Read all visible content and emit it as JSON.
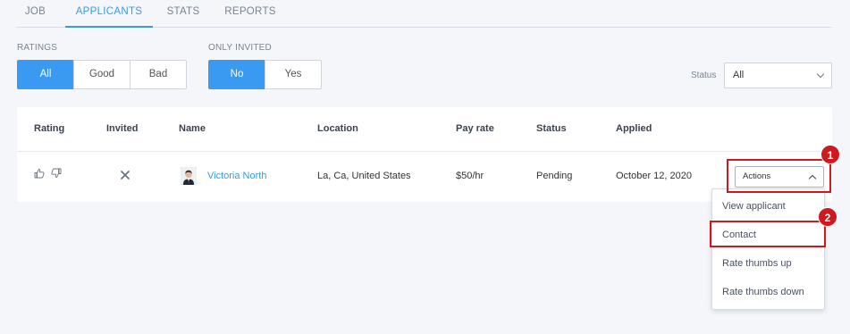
{
  "tabs": [
    {
      "label": "JOB",
      "active": false
    },
    {
      "label": "APPLICANTS",
      "active": true
    },
    {
      "label": "STATS",
      "active": false
    },
    {
      "label": "REPORTS",
      "active": false
    }
  ],
  "filters": {
    "ratings": {
      "label": "RATINGS",
      "options": [
        "All",
        "Good",
        "Bad"
      ],
      "selected": "All"
    },
    "only_invited": {
      "label": "ONLY INVITED",
      "options": [
        "No",
        "Yes"
      ],
      "selected": "No"
    },
    "status": {
      "label": "Status",
      "value": "All"
    }
  },
  "table": {
    "headers": [
      "Rating",
      "Invited",
      "Name",
      "Location",
      "Pay rate",
      "Status",
      "Applied"
    ],
    "rows": [
      {
        "name": "Victoria North",
        "location": "La, Ca, United States",
        "pay_rate": "$50/hr",
        "status": "Pending",
        "applied": "October 12, 2020"
      }
    ],
    "actions_label": "Actions"
  },
  "actions_menu": {
    "items": [
      "View applicant",
      "Contact",
      "Rate thumbs up",
      "Rate thumbs down"
    ]
  },
  "annotations": {
    "badge1": "1",
    "badge2": "2"
  },
  "colors": {
    "accent": "#3a99f0",
    "highlight": "#d0191f"
  }
}
